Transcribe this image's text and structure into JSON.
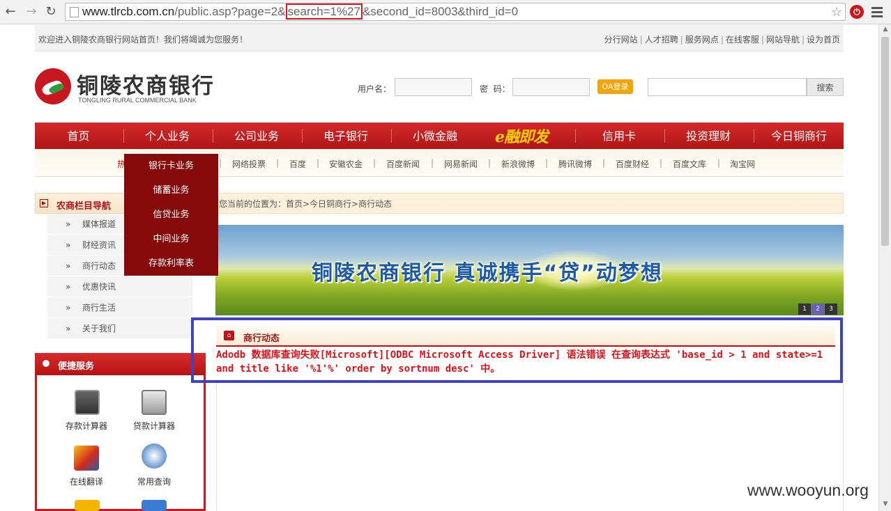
{
  "browser": {
    "url_host": "www.tlrcb.com.cn",
    "url_pre": "/public.asp?page=2&",
    "url_highlight": "search=1%27",
    "url_post": "&second_id=8003&third_id=0"
  },
  "topbar": {
    "welcome": "欢迎进入铜陵农商银行网站首页！我们将竭诚为您服务！",
    "links": [
      "分行网站",
      "人才招聘",
      "服务网点",
      "在线客服",
      "网站导航",
      "设为首页"
    ]
  },
  "logo": {
    "cn": "铜陵农商银行",
    "en": "TONGLING RURAL COMMERCIAL BANK"
  },
  "login": {
    "username_label": "用户名：",
    "password_label": "密  码：",
    "login_button": "OA登录",
    "search_button": "搜索"
  },
  "mainnav": {
    "items": [
      "首页",
      "个人业务",
      "公司业务",
      "电子银行",
      "小微金融",
      "e融即发",
      "信用卡",
      "投资理财",
      "今日铜商行"
    ]
  },
  "subnav": {
    "hot_label": "热",
    "links": [
      "网络投票",
      "百度",
      "安徽农金",
      "百度新闻",
      "网易新闻",
      "新浪微博",
      "腾讯微博",
      "百度财经",
      "百度文库",
      "淘宝网"
    ]
  },
  "dropdown": {
    "items": [
      "银行卡业务",
      "储蓄业务",
      "信贷业务",
      "中间业务",
      "存款利率表"
    ]
  },
  "leftnav": {
    "title": "农商栏目导航",
    "items": [
      "媒体报道",
      "财经资讯",
      "商行动态",
      "优惠快讯",
      "商行生活",
      "关于我们"
    ],
    "arrow": "»"
  },
  "quick": {
    "title": "便捷服务",
    "items": [
      "存款计算器",
      "贷款计算器",
      "在线翻译",
      "常用查询"
    ]
  },
  "breadcrumb": "您当前的位置为：首页>今日铜商行>商行动态",
  "banner": {
    "text": "铜陵农商银行  真诚携手“贷”动梦想",
    "dots": [
      "1",
      "2",
      "3"
    ]
  },
  "content": {
    "title": "商行动态",
    "error": "Adodb 数据库查询失败[Microsoft][ODBC Microsoft Access Driver] 语法错误 在查询表达式 'base_id > 1 and state>=1 and title like '%1'%' order by sortnum desc' 中。"
  },
  "watermark": "www.wooyun.org"
}
